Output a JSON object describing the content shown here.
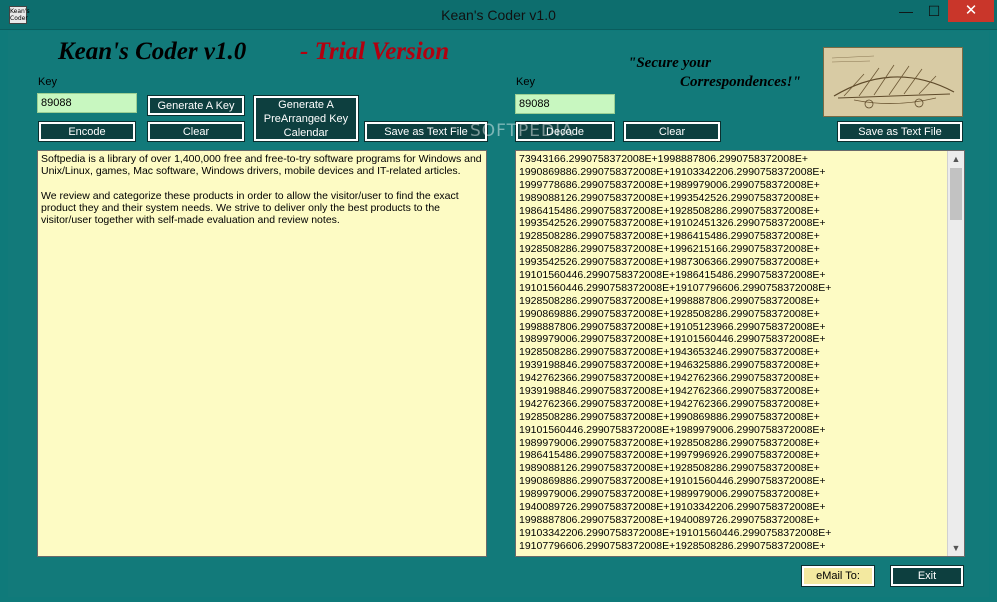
{
  "window": {
    "title": "Kean's Coder v1.0",
    "icon_text": "Kean's Coder",
    "minimize": "—",
    "maximize": "☐",
    "close": "✕"
  },
  "header": {
    "app_title": "Kean's Coder v1.0",
    "trial": "- Trial Version",
    "slogan_line1": "\"Secure your",
    "slogan_line2": "Correspondences!\""
  },
  "left": {
    "key_label": "Key",
    "key_value": "89088",
    "generate_key": "Generate A Key",
    "generate_calendar": "Generate A PreArranged Key Calendar",
    "encode": "Encode",
    "clear": "Clear",
    "save": "Save as Text File",
    "text_p1": "Softpedia is a library of over 1,400,000 free and free-to-try software programs for Windows and Unix/Linux, games, Mac software, Windows drivers, mobile devices and IT-related articles.",
    "text_p2": "We review and categorize these products in order to allow the visitor/user to find the exact product they and their system needs. We strive to deliver only the best products to the visitor/user together with self-made evaluation and review notes."
  },
  "right": {
    "key_label": "Key",
    "key_value": "89088",
    "decode": "Decode",
    "clear": "Clear",
    "save": "Save as Text File",
    "lines": [
      "73943166.2990758372008E+1998887806.2990758372008E+",
      "1990869886.2990758372008E+19103342206.2990758372008E+",
      "1999778686.2990758372008E+1989979006.2990758372008E+",
      "1989088126.2990758372008E+1993542526.2990758372008E+",
      "1986415486.2990758372008E+1928508286.2990758372008E+",
      "1993542526.2990758372008E+19102451326.2990758372008E+",
      "1928508286.2990758372008E+1986415486.2990758372008E+",
      "1928508286.2990758372008E+1996215166.2990758372008E+",
      "1993542526.2990758372008E+1987306366.2990758372008E+",
      "19101560446.2990758372008E+1986415486.2990758372008E+",
      "19101560446.2990758372008E+19107796606.2990758372008E+",
      "1928508286.2990758372008E+1998887806.2990758372008E+",
      "1990869886.2990758372008E+1928508286.2990758372008E+",
      "1998887806.2990758372008E+19105123966.2990758372008E+",
      "1989979006.2990758372008E+19101560446.2990758372008E+",
      "1928508286.2990758372008E+1943653246.2990758372008E+",
      "1939198846.2990758372008E+1946325886.2990758372008E+",
      "1942762366.2990758372008E+1942762366.2990758372008E+",
      "1939198846.2990758372008E+1942762366.2990758372008E+",
      "1942762366.2990758372008E+1942762366.2990758372008E+",
      "1928508286.2990758372008E+1990869886.2990758372008E+",
      "19101560446.2990758372008E+1989979006.2990758372008E+",
      "1989979006.2990758372008E+1928508286.2990758372008E+",
      "1986415486.2990758372008E+1997996926.2990758372008E+",
      "1989088126.2990758372008E+1928508286.2990758372008E+",
      "1990869886.2990758372008E+19101560446.2990758372008E+",
      "1989979006.2990758372008E+1989979006.2990758372008E+",
      "1940089726.2990758372008E+19103342206.2990758372008E+",
      "1998887806.2990758372008E+1940089726.2990758372008E+",
      "19103342206.2990758372008E+19101560446.2990758372008E+",
      "19107796606.2990758372008E+1928508286.2990758372008E+"
    ],
    "scroll_up": "▲",
    "scroll_down": "▼"
  },
  "footer": {
    "email": "eMail To:",
    "exit": "Exit"
  },
  "watermark": "SOFTPEDIA",
  "colors": {
    "background": "#127a7a",
    "button": "#0d3f3f",
    "text_area": "#fdfbc4",
    "key_field": "#c8f7c0",
    "trial_red": "#b3000f"
  }
}
